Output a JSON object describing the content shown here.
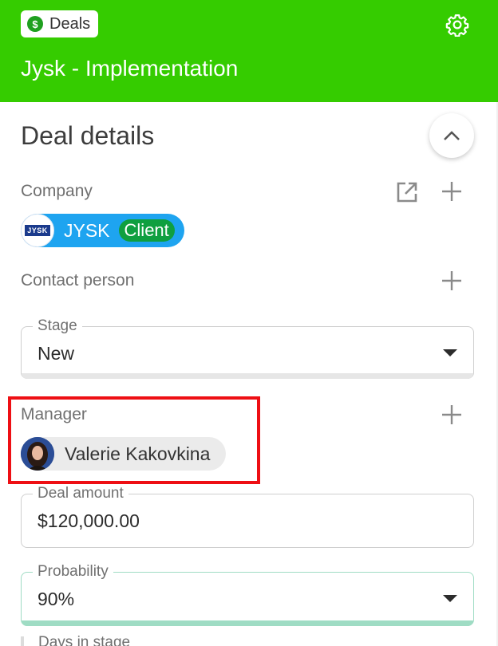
{
  "header": {
    "chip_label": "Deals",
    "chip_icon": "dollar-icon",
    "title": "Jysk - Implementation",
    "bg_color": "#35cc00"
  },
  "section": {
    "title": "Deal details"
  },
  "company": {
    "label": "Company",
    "name": "JYSK",
    "badge": "Client",
    "logo_text": "JYSK"
  },
  "contact": {
    "label": "Contact person"
  },
  "stage": {
    "label": "Stage",
    "value": "New"
  },
  "manager": {
    "label": "Manager",
    "name": "Valerie Kakovkina"
  },
  "deal_amount": {
    "label": "Deal amount",
    "value": "$120,000.00"
  },
  "probability": {
    "label": "Probability",
    "value": "90%"
  },
  "days_in_stage": {
    "label": "Days in stage"
  },
  "icons": [
    "dollar-icon",
    "gear-icon",
    "chevron-up-icon",
    "open-external-icon",
    "plus-icon",
    "dropdown-arrow-icon"
  ],
  "colors": {
    "brand_green": "#35cc00",
    "company_chip": "#1ea4f0",
    "client_badge": "#0f9f3f",
    "highlight": "#ee0f14",
    "probability_accent": "#9fdcc4"
  }
}
